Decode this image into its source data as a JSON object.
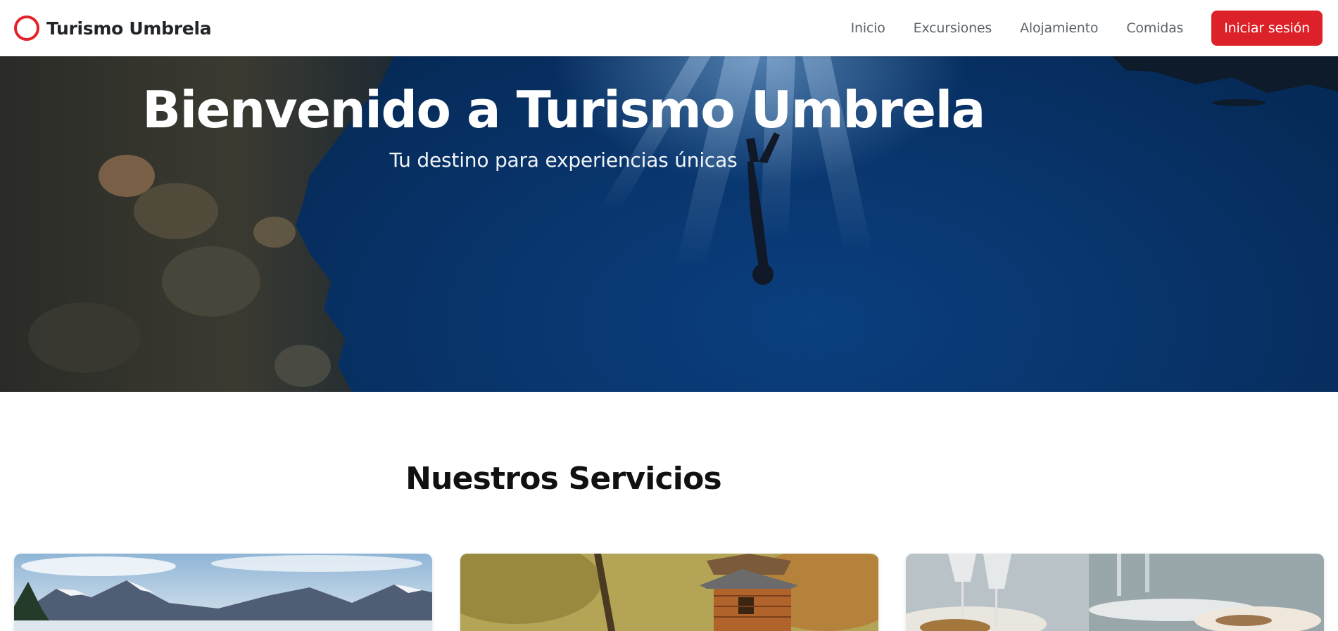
{
  "brand": {
    "name": "Turismo Umbrela",
    "logo_color": "#e3232b"
  },
  "nav": {
    "links": [
      "Inicio",
      "Excursiones",
      "Alojamiento",
      "Comidas"
    ],
    "login_label": "Iniciar sesión",
    "login_color": "#dc2128"
  },
  "hero": {
    "title": "Bienvenido a Turismo Umbrela",
    "subtitle": "Tu destino para experiencias únicas",
    "image": "underwater-diver-image"
  },
  "services": {
    "title": "Nuestros Servicios",
    "cards": [
      {
        "image": "mountain-landscape-image"
      },
      {
        "image": "treehouse-cabin-image"
      },
      {
        "image": "restaurant-table-image"
      }
    ]
  }
}
